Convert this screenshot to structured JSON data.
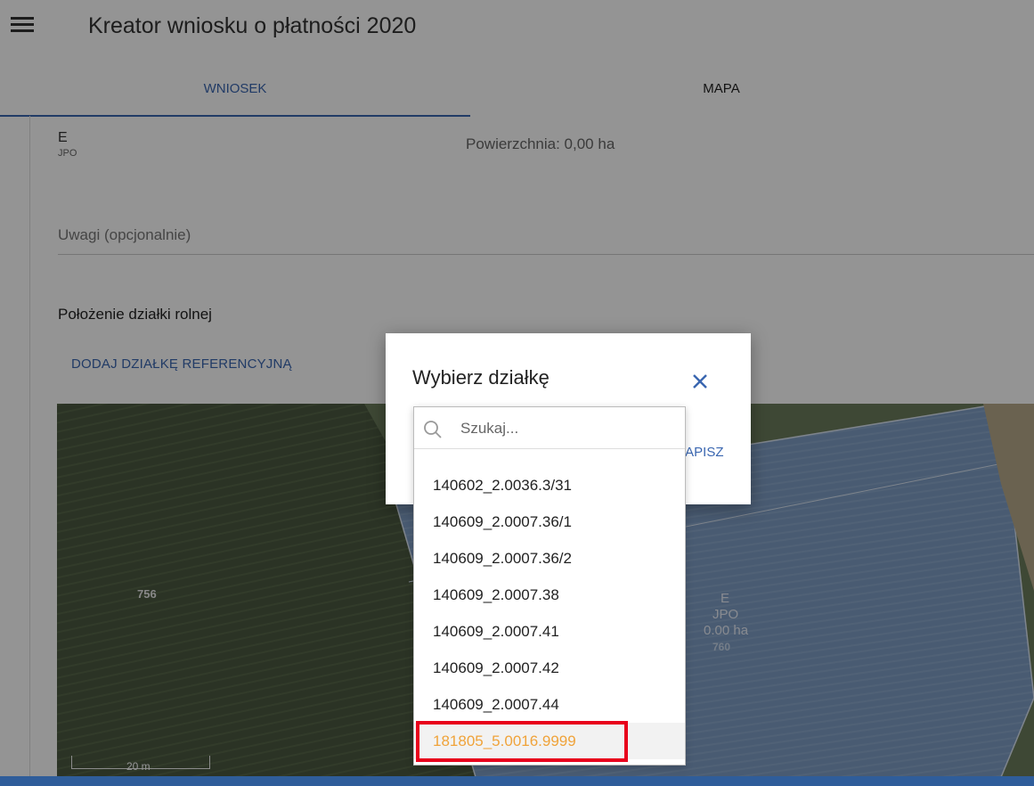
{
  "app": {
    "title": "Kreator wniosku o płatności 2020"
  },
  "tabs": [
    {
      "label": "WNIOSEK"
    },
    {
      "label": "MAPA"
    }
  ],
  "form": {
    "field_code": "E",
    "field_sub": "JPO",
    "area": "Powierzchnia: 0,00 ha",
    "notes_placeholder": "Uwagi (opcjonalnie)",
    "section_title": "Położenie działki rolnej",
    "add_reference": "DODAJ DZIAŁKĘ REFERENCYJNĄ"
  },
  "map": {
    "parcel_left_label": "756",
    "parcel_code": "E",
    "parcel_sub": "JPO",
    "parcel_area": "0.00 ha",
    "parcel_number": "760",
    "scale_label": "20 m"
  },
  "dialog": {
    "title": "Wybierz działkę",
    "save_label": "ZAPISZ",
    "search_placeholder": "Szukaj...",
    "options": [
      "140602_2.0036.3/31",
      "140609_2.0007.36/1",
      "140609_2.0007.36/2",
      "140609_2.0007.38",
      "140609_2.0007.41",
      "140609_2.0007.42",
      "140609_2.0007.44",
      "181805_5.0016.9999"
    ],
    "selected_option": "181805_5.0016.9999"
  },
  "colors": {
    "accent": "#3a66b0",
    "highlight": "#e8001c",
    "selected_text": "#f0a33a",
    "bottom_bar": "#2f5d9a"
  },
  "icons": {
    "menu": "hamburger-menu-icon",
    "close": "close-icon",
    "search": "search-icon"
  }
}
